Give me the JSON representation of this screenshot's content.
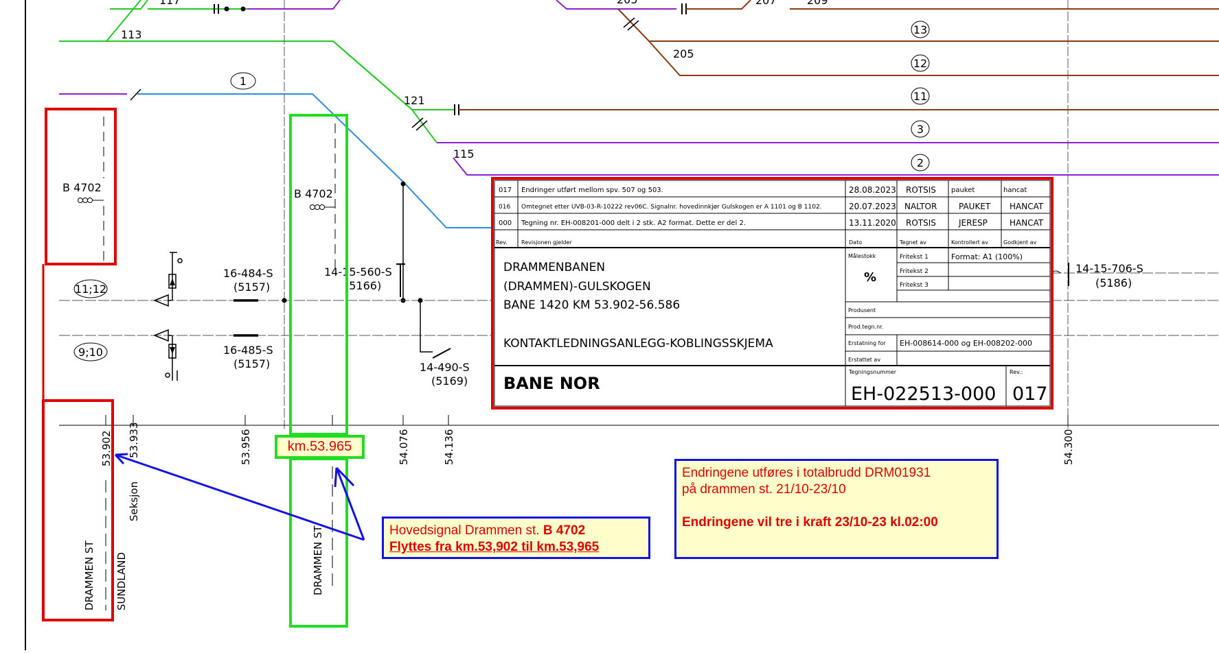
{
  "track_labels": {
    "t117": "117",
    "t113": "113",
    "t121": "121",
    "t115": "115",
    "t205a": "205",
    "t205b": "205",
    "t207": "207",
    "t209": "209"
  },
  "track_circles": [
    "1",
    "13",
    "12",
    "11",
    "3",
    "2",
    "11;12",
    "9;10"
  ],
  "signals": {
    "b4702_old": "B 4702",
    "b4702_new": "B 4702"
  },
  "switches": {
    "s16_484": "16-484-S",
    "s16_484_num": "(5157)",
    "s16_485": "16-485-S",
    "s16_485_num": "(5157)",
    "s14_15_560": "14-15-560-S",
    "s14_15_560_num": "(5166)",
    "s14_490": "14-490-S",
    "s14_490_num": "(5169)",
    "s14_15_706": "14-15-706-S",
    "s14_15_706_num": "(5186)"
  },
  "km_axis": {
    "ticks": [
      "53.902",
      "53.933",
      "53.956",
      "54.076",
      "54.136",
      "54.300"
    ],
    "seksjon": "Seksjon",
    "drammen_st_left": "DRAMMEN ST",
    "sundland": "SUNDLAND",
    "drammen_st_mid": "DRAMMEN ST"
  },
  "title_block": {
    "revisions": [
      {
        "rev": "017",
        "text": "Endringer utført mellom spv. 507 og 503.",
        "date": "28.08.2023",
        "drawn": "ROTSIS",
        "checked": "pauket",
        "approved": "hancat"
      },
      {
        "rev": "016",
        "text": "Omtegnet etter UVB-03-R-10222 rev06C. Signalnr. hovedinnkjør Gulskogen er A 1101 og B 1102.",
        "date": "20.07.2023",
        "drawn": "NALTOR",
        "checked": "PAUKET",
        "approved": "HANCAT"
      },
      {
        "rev": "000",
        "text": "Tegning nr. EH-008201-000 delt i 2 stk. A2 format. Dette er del 2.",
        "date": "13.11.2020",
        "drawn": "ROTSIS",
        "checked": "JERESP",
        "approved": "HANCAT"
      }
    ],
    "header": {
      "rev": "Rev.",
      "text": "Revisjonen gjelder",
      "date": "Dato",
      "drawn": "Tegnet av",
      "checked": "Kontrollert av",
      "approved": "Godkjent av"
    },
    "project_lines": [
      "DRAMMENBANEN",
      "(DRAMMEN)-GULSKOGEN",
      "BANE 1420 KM 53.902-56.586"
    ],
    "drawing_title": "KONTAKTLEDNINGSANLEGG-KOBLINGSSKJEMA",
    "company": "BANE NOR",
    "malestokk_label": "Målestokk",
    "malestokk_value": "%",
    "fritekst1": "Fritekst 1",
    "fritekst2": "Fritekst 2",
    "fritekst3": "Fritekst 3",
    "format": "Format: A1 (100%)",
    "produsent": "Produsent",
    "prod_tegn": "Prod.tegn.nr.",
    "erstatning_label": "Erstatning for",
    "erstatning_value": "EH-008614-000 og EH-008202-000",
    "erstattet": "Erstattet av",
    "tegningsnummer_label": "Tegningsnummer",
    "tegningsnummer": "EH-022513-000",
    "rev_label": "Rev.:",
    "rev_value": "017"
  },
  "annotations": {
    "km_tag": "km.53.965",
    "hovedsignal_line1": "Hovedsignal Drammen st. ",
    "hovedsignal_bold": "B 4702",
    "hovedsignal_line2": "Flyttes fra km.53,902 til km.53,965",
    "endring_line1": "Endringene utføres i totalbrudd DRM01931",
    "endring_line2": "på drammen st. 21/10-23/10",
    "endring_line3": "Endringene vil tre i kraft 23/10-23 kl.02:00"
  },
  "colors": {
    "green": "#22cc22",
    "purple": "#8b1fd1",
    "brown": "#8b3a0f",
    "blue": "#2a8be0",
    "red": "#e00000",
    "note_border": "#1212e6",
    "note_fill": "#ffffcc"
  }
}
